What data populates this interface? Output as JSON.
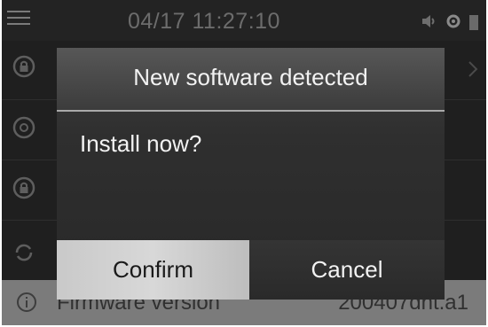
{
  "status_bar": {
    "datetime": "04/17 11:27:10",
    "icons": [
      "menu-icon",
      "volume-icon",
      "settings-icon",
      "battery-icon"
    ]
  },
  "sidebar": {
    "icons": [
      "lock-icon",
      "at-icon",
      "lock-icon",
      "refresh-icon"
    ]
  },
  "firmware_row": {
    "icon": "info-icon",
    "label": "Firmware version",
    "value": "200407dnt.a1"
  },
  "dialog": {
    "title": "New software detected",
    "message": "Install now?",
    "confirm_label": "Confirm",
    "cancel_label": "Cancel"
  },
  "colors": {
    "screen_bg": "#1f1f1f",
    "dialog_bg": "#2f2f2f",
    "confirm_bg": "#d0d0d0",
    "text_light": "#f2f2f2"
  }
}
